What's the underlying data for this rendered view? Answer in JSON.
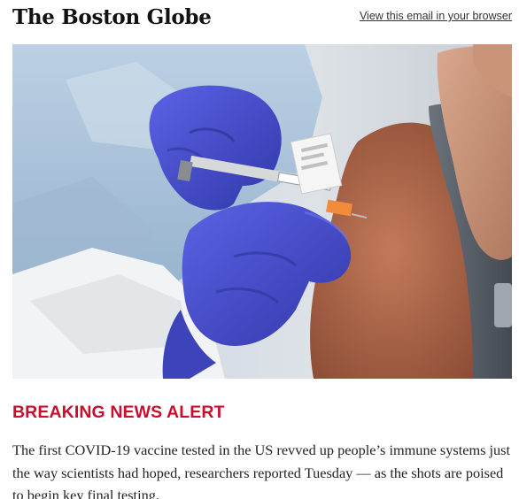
{
  "masthead": {
    "logo_text": "The Boston Globe",
    "view_in_browser": "View this email in your browser"
  },
  "hero_image": {
    "subject": "vaccine injection photo",
    "colors": {
      "glove": "#4a4fd0",
      "gown": "#a9c3dc",
      "skin": "#b06a4d",
      "shirt": "#5b636c",
      "background": "#d8dde3"
    }
  },
  "alert": {
    "headline": "BREAKING NEWS ALERT",
    "headline_color": "#c8102e",
    "body": "The first COVID-19 vaccine tested in the US revved up people’s immune systems just the way scientists had hoped, researchers reported Tuesday — as the shots are poised to begin key final testing."
  }
}
